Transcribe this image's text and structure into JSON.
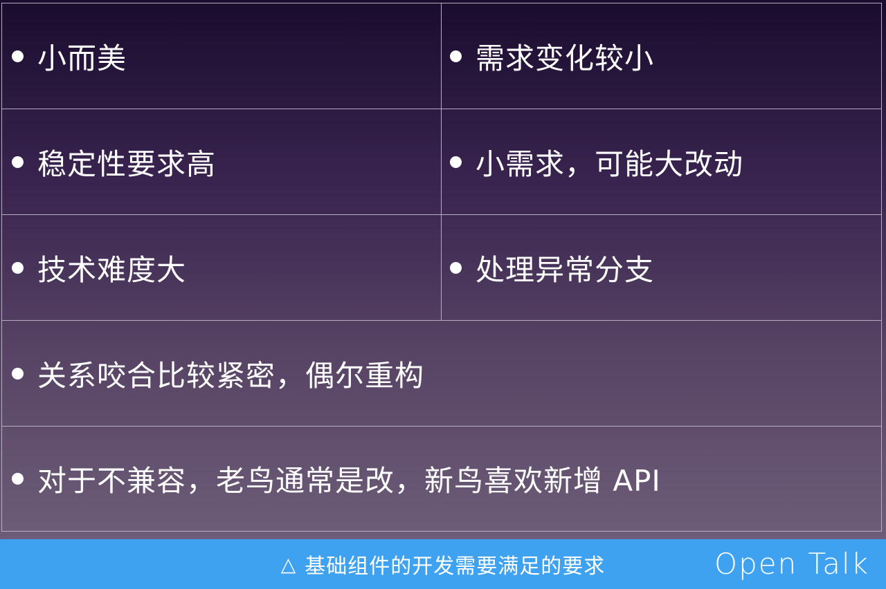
{
  "table": {
    "rows": [
      {
        "left": "小而美",
        "right": "需求变化较小"
      },
      {
        "left": "稳定性要求高",
        "right": "小需求，可能大改动"
      },
      {
        "left": "技术难度大",
        "right": "处理异常分支"
      },
      {
        "full": "关系咬合比较紧密，偶尔重构"
      },
      {
        "full": "对于不兼容，老鸟通常是改，新鸟喜欢新增 API"
      }
    ]
  },
  "caption": {
    "icon": "triangle-icon",
    "text": "基础组件的开发需要满足的要求"
  },
  "brand": {
    "text": "Open Talk"
  },
  "colors": {
    "caption_bar": "#3fa2f0",
    "grid_lines": "#b8aec4",
    "text": "#ffffff"
  }
}
